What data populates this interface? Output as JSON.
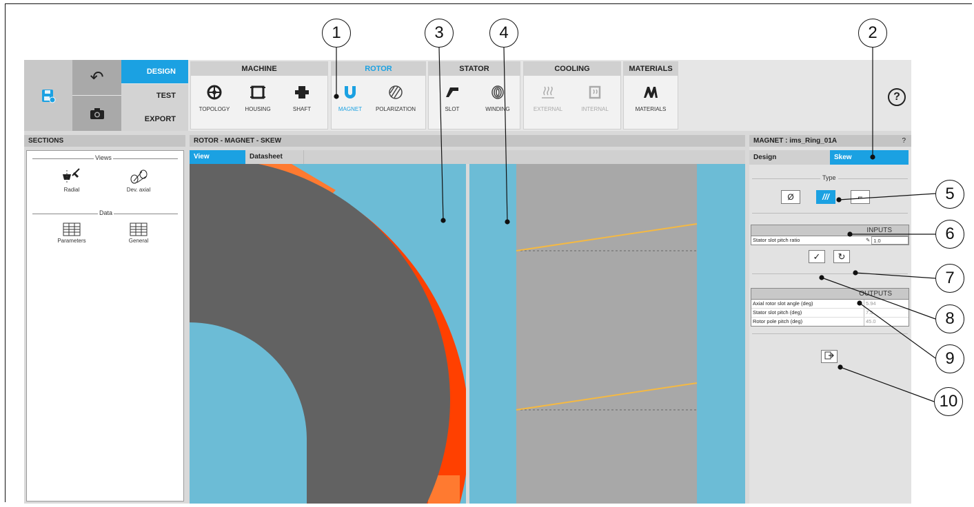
{
  "callouts": [
    "1",
    "2",
    "3",
    "4",
    "5",
    "6",
    "7",
    "8",
    "9",
    "10"
  ],
  "quick_access": {
    "save_icon": "save-icon",
    "undo_icon": "undo-icon",
    "camera_icon": "camera-icon"
  },
  "modes": [
    "DESIGN",
    "TEST",
    "EXPORT"
  ],
  "groups": {
    "machine": {
      "title": "MACHINE",
      "tools": [
        "TOPOLOGY",
        "HOUSING",
        "SHAFT"
      ]
    },
    "rotor": {
      "title": "ROTOR",
      "tools": [
        "MAGNET",
        "POLARIZATION"
      ]
    },
    "stator": {
      "title": "STATOR",
      "tools": [
        "SLOT",
        "WINDING"
      ]
    },
    "cooling": {
      "title": "COOLING",
      "tools": [
        "EXTERNAL",
        "INTERNAL"
      ]
    },
    "materials": {
      "title": "MATERIALS",
      "tools": [
        "MATERIALS"
      ]
    }
  },
  "help": "?",
  "sections": {
    "title": "SECTIONS",
    "views_label": "Views",
    "views": [
      "Radial",
      "Dev. axial"
    ],
    "data_label": "Data",
    "data": [
      "Parameters",
      "General"
    ]
  },
  "center": {
    "title": "ROTOR - MAGNET - SKEW",
    "tabs": [
      "View",
      "Datasheet"
    ]
  },
  "right": {
    "title": "MAGNET : ims_Ring_01A",
    "help": "?",
    "tabs": [
      "Design",
      "Skew"
    ],
    "type_label": "Type",
    "type_buttons": [
      "Ø",
      "///",
      "⌐"
    ],
    "inputs_title": "INPUTS",
    "inputs": [
      {
        "label": "Stator slot pitch ratio",
        "value": "1.0"
      }
    ],
    "outputs_title": "OUTPUTS",
    "outputs": [
      {
        "label": "Axial rotor slot angle (deg)",
        "value": "5.94"
      },
      {
        "label": "Stator slot pitch (deg)",
        "value": "7.5"
      },
      {
        "label": "Rotor pole pitch (deg)",
        "value": "45.0"
      }
    ]
  },
  "colors": {
    "accent": "#1ba1e2",
    "background_blue": "#6cbcd6",
    "rotor_core": "#626262",
    "magnet_red": "#ff4000",
    "magnet_orange": "#ff7a30",
    "axial_gray": "#a8a8a8",
    "skew_line": "#f5b942"
  }
}
